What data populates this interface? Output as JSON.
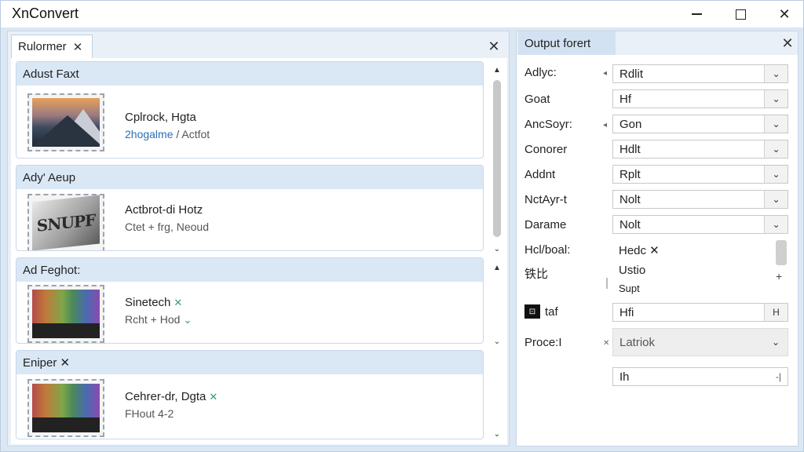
{
  "window": {
    "title": "XnConvert",
    "minimize": "—",
    "close": "✕"
  },
  "left_panel": {
    "tab_label": "Rulormer",
    "tab_close": "✕",
    "panel_close": "✕",
    "cards": [
      {
        "header": "Adust Faxt",
        "thumb": "mountain-photo",
        "line1": "Cplrock, Hgta",
        "line2_accent": "2hogalme",
        "line2_rest": " / Actfot",
        "line1_icon": "",
        "line2_icon": ""
      },
      {
        "header": "Ady' Aeup",
        "thumb": "sign-photo",
        "thumb_text": "SNUPF",
        "line1": "Actbrot-di Hotz",
        "line2_accent": "",
        "line2_rest": "Ctet + frg, Neoud",
        "line1_icon": "",
        "line2_icon": ""
      },
      {
        "header": "Ad Feghot:",
        "thumb": "color-bars",
        "line1": "Sinetech",
        "line2_accent": "",
        "line2_rest": "Rcht + Hod",
        "line1_icon": "✕",
        "line2_icon": "⌄"
      },
      {
        "header": "Eniper ✕",
        "thumb": "color-bars",
        "line1": "Cehrer-dr, Dgta",
        "line2_accent": "",
        "line2_rest": "FHout 4-2",
        "line1_icon": "✕",
        "line2_icon": ""
      }
    ]
  },
  "right_panel": {
    "tab_label": "Output forert",
    "panel_close": "✕",
    "rows": [
      {
        "label": "Adlyc:",
        "value": "Rdlit"
      },
      {
        "label": "Goat",
        "value": "Hf"
      },
      {
        "label": "AncSoyr:",
        "value": "Gon"
      },
      {
        "label": "Conorer",
        "value": "Hdlt"
      },
      {
        "label": "Addnt",
        "value": "Rplt"
      },
      {
        "label": "NctAyr-t",
        "value": "Nolt"
      },
      {
        "label": "Darame",
        "value": "Nolt"
      }
    ],
    "list_label_1": "Hcl/boal:",
    "list_label_2": "铁比",
    "list_items": [
      "Hedc ✕",
      "Ustio",
      "Supt"
    ],
    "list_plus": "+",
    "image_row_label": "taf",
    "image_row_icon_text": "⊡",
    "image_row_value": "Hfi",
    "image_row_btn": "H",
    "process_label": "Proce:I",
    "process_value": "Latriok",
    "bottom_input_value": "Ih",
    "bottom_input_end": "-|"
  },
  "icons": {
    "chevron": "⌄",
    "arrow_up": "▲",
    "arrow_down": "⌄"
  }
}
